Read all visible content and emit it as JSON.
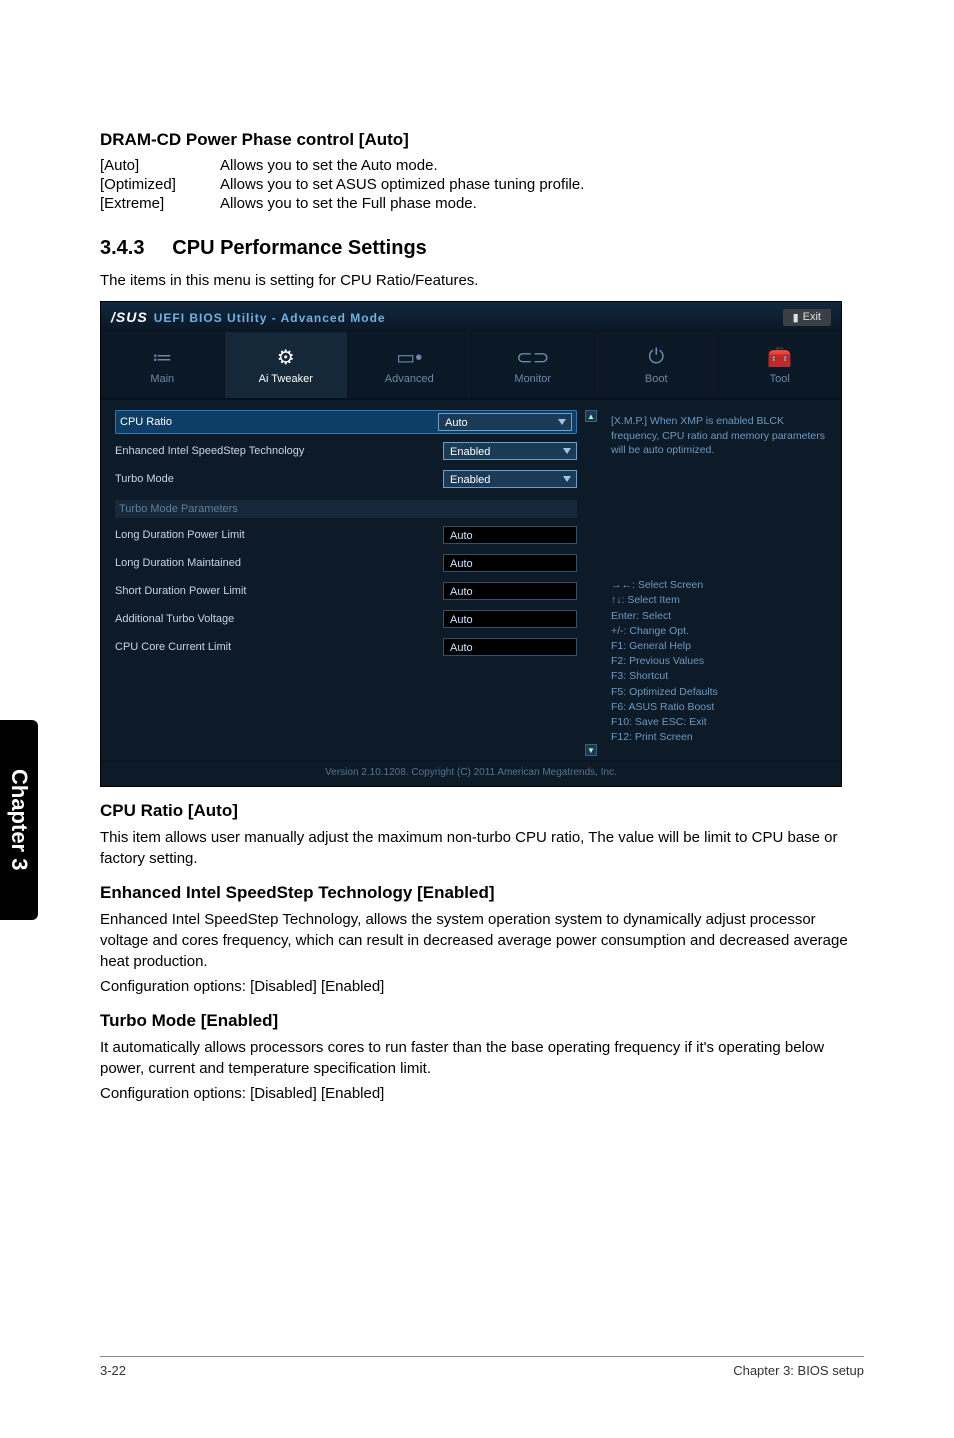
{
  "section1": {
    "title": "DRAM-CD Power Phase control [Auto]",
    "rows": [
      {
        "k": "[Auto]",
        "v": "Allows you to set the Auto mode."
      },
      {
        "k": "[Optimized]",
        "v": "Allows you to set ASUS optimized phase tuning profile."
      },
      {
        "k": "[Extreme]",
        "v": "Allows you to set the Full phase mode."
      }
    ]
  },
  "section_num": {
    "num": "3.4.3",
    "title": "CPU Performance Settings",
    "intro": "The items in this menu is setting for CPU Ratio/Features."
  },
  "bios": {
    "brand_asus": "/SUS",
    "brand_rest": "UEFI BIOS Utility - Advanced Mode",
    "exit_label": "Exit",
    "tabs": [
      {
        "label": "Main",
        "glyph": "≔"
      },
      {
        "label": "Ai Tweaker",
        "glyph": "⚙"
      },
      {
        "label": "Advanced",
        "glyph": "▭•"
      },
      {
        "label": "Monitor",
        "glyph": "⊂⊃"
      },
      {
        "label": "Boot",
        "glyph": "⏻"
      },
      {
        "label": "Tool",
        "glyph": "🧰"
      }
    ],
    "active_tab": 1,
    "rows": [
      {
        "label": "CPU Ratio",
        "value": "Auto",
        "type": "combo",
        "selected": true
      },
      {
        "label": "Enhanced Intel SpeedStep Technology",
        "value": "Enabled",
        "type": "combo"
      },
      {
        "label": "Turbo Mode",
        "value": "Enabled",
        "type": "combo"
      }
    ],
    "group_header": "Turbo Mode Parameters",
    "rows2": [
      {
        "label": "Long Duration Power Limit",
        "value": "Auto",
        "type": "text"
      },
      {
        "label": "Long Duration Maintained",
        "value": "Auto",
        "type": "text"
      },
      {
        "label": "Short Duration Power Limit",
        "value": "Auto",
        "type": "text"
      },
      {
        "label": "Additional Turbo Voltage",
        "value": "Auto",
        "type": "text"
      },
      {
        "label": "CPU Core Current Limit",
        "value": "Auto",
        "type": "text"
      }
    ],
    "help_text": "[X.M.P.] When XMP is enabled BLCK frequency, CPU ratio and memory parameters will be auto optimized.",
    "keys": [
      "→←: Select Screen",
      "↑↓: Select Item",
      "Enter: Select",
      "+/-: Change Opt.",
      "F1: General Help",
      "F2: Previous Values",
      "F3: Shortcut",
      "F5: Optimized Defaults",
      "F6: ASUS Ratio Boost",
      "F10: Save   ESC: Exit",
      "F12: Print Screen"
    ],
    "footer": "Version 2.10.1208.  Copyright (C) 2011 American Megatrends, Inc."
  },
  "post": [
    {
      "title": "CPU Ratio [Auto]",
      "paras": [
        "This item allows user manually adjust the maximum non-turbo CPU ratio, The value will be limit to CPU base or factory setting."
      ]
    },
    {
      "title": "Enhanced Intel SpeedStep Technology [Enabled]",
      "paras": [
        "Enhanced Intel SpeedStep Technology, allows the system operation system to dynamically adjust processor voltage and cores frequency, which can result in decreased average power consumption and decreased average heat production.",
        "Configuration options: [Disabled] [Enabled]"
      ]
    },
    {
      "title": "Turbo Mode [Enabled]",
      "paras": [
        "It automatically allows processors cores to run faster than the base operating frequency if it's operating below power, current and temperature specification limit.",
        "Configuration options: [Disabled] [Enabled]"
      ]
    }
  ],
  "side_tab": "Chapter 3",
  "footer_left": "3-22",
  "footer_right": "Chapter 3: BIOS setup"
}
